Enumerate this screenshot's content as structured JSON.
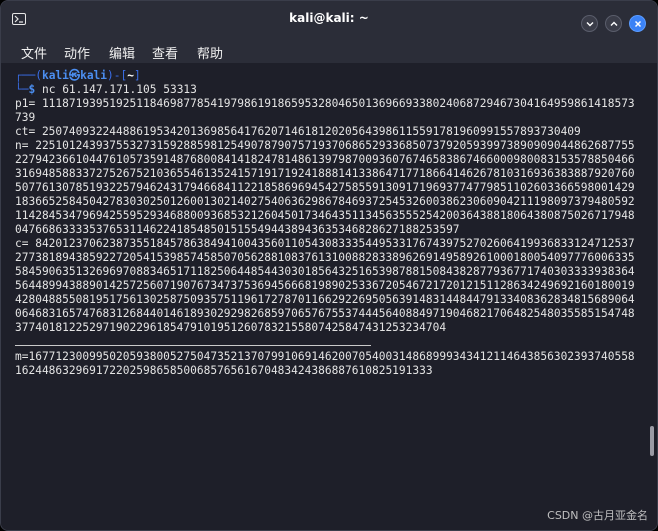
{
  "window": {
    "title": "kali@kali: ~"
  },
  "menu": {
    "items": [
      "文件",
      "动作",
      "编辑",
      "查看",
      "帮助"
    ]
  },
  "prompt": {
    "top_prefix": "┌──(",
    "user": "kali㉿kali",
    "mid": ")-[",
    "dir": "~",
    "close": "]",
    "bottom_prefix": "└─",
    "dollar": "$",
    "command": "nc 61.147.171.105 53313"
  },
  "output": {
    "p1": "p1= 111871939519251184698778541979861918659532804650136966933802406872946730416495986141857373​9",
    "ct": "ct= 25074093224488619534201369856417620714618120205643986115591781960991557893730409",
    "n": "n= 22510124393755327315928859812549078790757193706865293368507379205939973890909044862687755227942366104476105735914876800841418247814861397987009360767465838674660009800831535788504663169485883372752675210365546135241571917192418881413386471771866414626781031693638388792076050776130785193225794624317946684112218586969454275855913091719693774779851102603366598001429183665258450427830302501260013021402754063629867846937254532600386230609042111980973794805921142845347969425595293468800936853212604501734643511345635552542003643881806438087502671794804766863333537653114622418548501515549443894363534682862718825359​7",
    "c": "c= 84201237062387355184578638494100435601105430833354495331767439752702606419936833124712537277381894385922720541539857458507056288108376131008828338962691495892610001800540977760063355845906351326969708834651711825064485443030185643251653987881508438287793677174030333393836456448994388901425725607190767347375369456668198902533672054672172012151128634249692160180019428048855081951756130258750935751196172787011662922695056391483144844791334083628348156890640646831657476831268440146189302929826859706576755374445640884971904682170648254803558515474837740181225297190229618547910195126078321558074258474312532347​04",
    "separator": "",
    "m": "m=16771230099502059380052750473521370799106914620070540031486899934341211464385630239374055816244863296917220259865850068576561670483424386887610825191333​"
  },
  "scrollbar": {
    "label": "scrollbar"
  },
  "watermark": "CSDN @古月亚金名"
}
